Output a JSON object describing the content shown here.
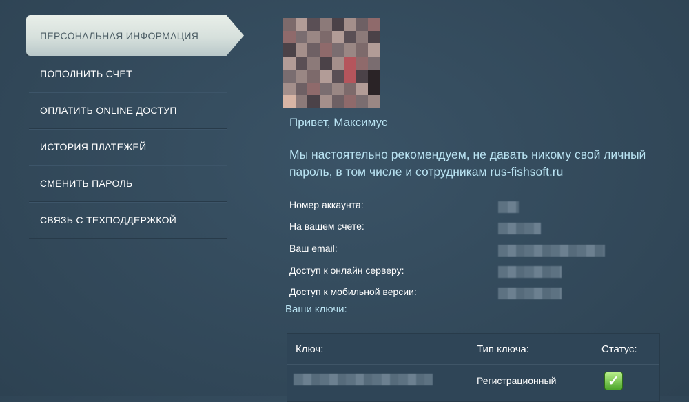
{
  "sidebar": {
    "items": [
      {
        "label": "ПЕРСОНАЛЬНАЯ ИНФОРМАЦИЯ",
        "active": true
      },
      {
        "label": "ПОПОЛНИТЬ СЧЕТ"
      },
      {
        "label": "ОПЛАТИТЬ ONLINE ДОСТУП"
      },
      {
        "label": "ИСТОРИЯ ПЛАТЕЖЕЙ"
      },
      {
        "label": "СМЕНИТЬ ПАРОЛЬ"
      },
      {
        "label": "СВЯЗЬ С ТЕХПОДДЕРЖКОЙ"
      }
    ]
  },
  "profile": {
    "greeting": "Привет, Максимус",
    "warning": "Мы настоятельно рекомендуем, не давать никому свой личный пароль, в том числе и сотрудникам rus-fishsoft.ru"
  },
  "info": {
    "account_label": "Номер аккаунта:",
    "balance_label": "На вашем счете:",
    "email_label": "Ваш email:",
    "online_label": "Доступ к онлайн серверу:",
    "mobile_label": "Доступ к мобильной версии:"
  },
  "keys": {
    "title": "Ваши ключи:",
    "col_key": "Ключ:",
    "col_type": "Тип ключа:",
    "col_status": "Статус:",
    "rows": [
      {
        "type": "Регистрационный",
        "status_icon": "check-icon"
      }
    ]
  },
  "colors": {
    "background": "#354c5e",
    "accent_text": "#b9e3f2",
    "active_tab": "#d6e0dc",
    "status_ok": "#4da62b"
  }
}
